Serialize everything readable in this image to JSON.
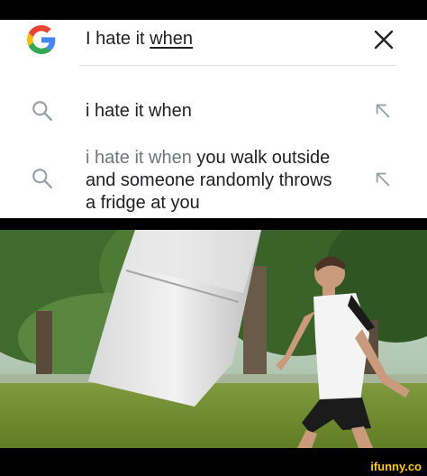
{
  "search": {
    "query_prefix": "I hate it",
    "query_underlined": "when",
    "logo_icon": "google-g-logo",
    "close_icon": "close-icon"
  },
  "suggestions": [
    {
      "prefix": "i hate it when",
      "rest_line1": "",
      "line2": "",
      "line3": "",
      "icon": "search-icon",
      "action_icon": "arrow-up-left-icon"
    },
    {
      "prefix": "i hate it when",
      "rest_line1": "you walk outside",
      "line2": "and someone randomly throws",
      "line3": "a fridge at you",
      "icon": "search-icon",
      "action_icon": "arrow-up-left-icon"
    }
  ],
  "watermark": "ifunny.co",
  "colors": {
    "google_blue": "#4285F4",
    "google_red": "#EA4335",
    "google_yellow": "#FBBC05",
    "google_green": "#34A853",
    "text": "#202124",
    "grey_text": "#70757a"
  }
}
